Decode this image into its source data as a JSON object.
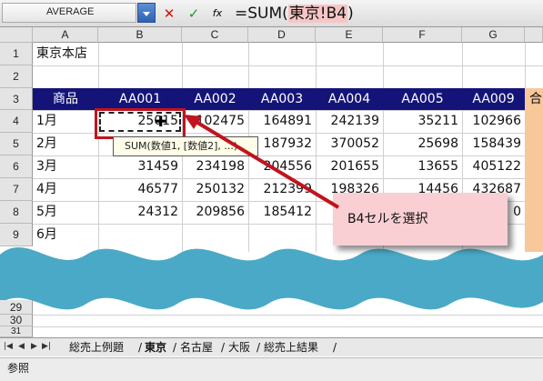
{
  "formula_bar": {
    "name_box": "AVERAGE",
    "cancel_icon": "✕",
    "enter_icon": "✓",
    "fx_icon": "fx",
    "formula_prefix": "=SUM(",
    "formula_ref": "東京!B4",
    "formula_suffix": ")"
  },
  "columns": [
    "A",
    "B",
    "C",
    "D",
    "E",
    "F",
    "G"
  ],
  "rows_top": [
    "1",
    "2",
    "3",
    "4",
    "5",
    "6",
    "7",
    "8",
    "9"
  ],
  "rows_bottom": [
    "29",
    "30",
    "31"
  ],
  "cells": {
    "a1": "東京本店",
    "header": [
      "商品",
      "AA001",
      "AA002",
      "AA003",
      "AA004",
      "AA005",
      "AA009"
    ],
    "header_extra": "合",
    "data": [
      {
        "label": "1月",
        "values": [
          "25015",
          "102475",
          "164891",
          "242139",
          "35211",
          "102966"
        ]
      },
      {
        "label": "2月",
        "values": [
          "",
          "",
          "187932",
          "370052",
          "25698",
          "158439"
        ]
      },
      {
        "label": "3月",
        "values": [
          "31459",
          "234198",
          "204556",
          "201655",
          "13655",
          "405122"
        ]
      },
      {
        "label": "4月",
        "values": [
          "46577",
          "250132",
          "212399",
          "198326",
          "14456",
          "432687"
        ]
      },
      {
        "label": "5月",
        "values": [
          "24312",
          "209856",
          "185412",
          "",
          "",
          "0"
        ]
      }
    ],
    "a9": "6月"
  },
  "tooltip": "SUM(数値1, [数値2], ...)",
  "callout": "B4セルを選択",
  "sheet_tabs": [
    "総売上例題",
    "東京",
    "名古屋",
    "大阪",
    "総売上結果"
  ],
  "status": "参照",
  "colors": {
    "header_band": "#141478",
    "accent_red": "#c0141e",
    "wave": "#4aa9c6",
    "callout_bg": "#f9cfd3",
    "orange_col": "#f8c89a"
  }
}
